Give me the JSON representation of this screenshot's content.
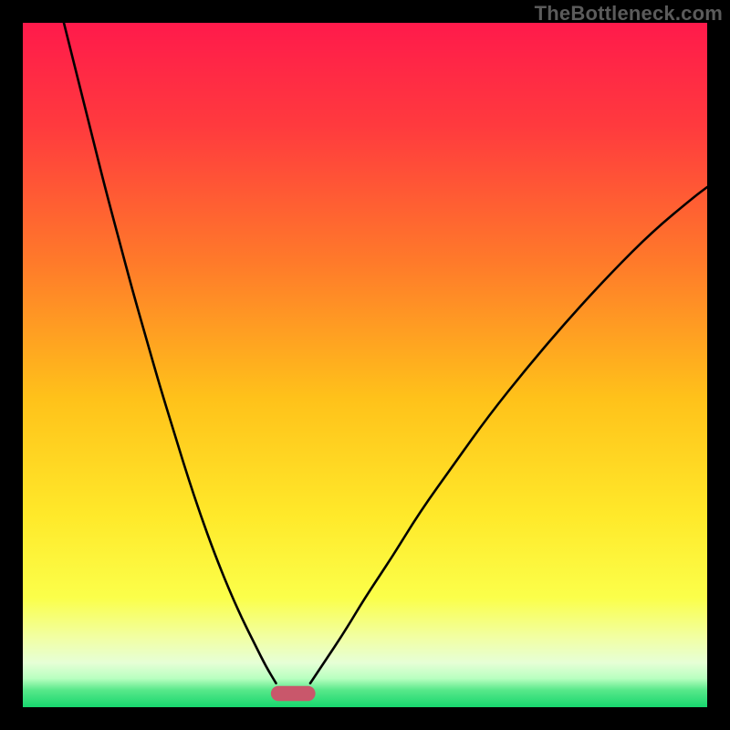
{
  "watermark": "TheBottleneck.com",
  "chart_data": {
    "type": "line",
    "title": "",
    "xlabel": "",
    "ylabel": "",
    "xlim": [
      0,
      100
    ],
    "ylim": [
      0,
      100
    ],
    "grid": false,
    "legend": false,
    "background_gradient_stops": [
      {
        "offset": 0.0,
        "color": "#ff1a4b"
      },
      {
        "offset": 0.15,
        "color": "#ff3a3e"
      },
      {
        "offset": 0.35,
        "color": "#ff7a2a"
      },
      {
        "offset": 0.55,
        "color": "#ffc21a"
      },
      {
        "offset": 0.72,
        "color": "#ffe92a"
      },
      {
        "offset": 0.84,
        "color": "#fbff4a"
      },
      {
        "offset": 0.9,
        "color": "#f1ffa6"
      },
      {
        "offset": 0.935,
        "color": "#e6ffd6"
      },
      {
        "offset": 0.958,
        "color": "#b8ffc0"
      },
      {
        "offset": 0.975,
        "color": "#58e88a"
      },
      {
        "offset": 1.0,
        "color": "#17d76e"
      }
    ],
    "series": [
      {
        "name": "left-branch",
        "x": [
          6,
          8,
          10,
          12,
          14,
          16,
          18,
          20,
          22,
          24,
          26,
          28,
          30,
          32,
          34,
          35.5,
          37
        ],
        "y": [
          100,
          92,
          84,
          76,
          68.5,
          61,
          54,
          47,
          40.5,
          34,
          28,
          22.5,
          17.5,
          13,
          9,
          6,
          3.5
        ]
      },
      {
        "name": "right-branch",
        "x": [
          42,
          44,
          47,
          50,
          54,
          58,
          63,
          68,
          74,
          80,
          86,
          92,
          98,
          100
        ],
        "y": [
          3.5,
          6.5,
          11,
          16,
          22,
          28.5,
          35.5,
          42.5,
          50,
          57,
          63.5,
          69.5,
          74.5,
          76
        ]
      }
    ],
    "annotations": [
      {
        "name": "bottom-marker",
        "shape": "rounded-rect",
        "x_center": 39.5,
        "y_center": 2.0,
        "width": 6.5,
        "height": 2.2,
        "color": "#c9576b"
      }
    ]
  }
}
